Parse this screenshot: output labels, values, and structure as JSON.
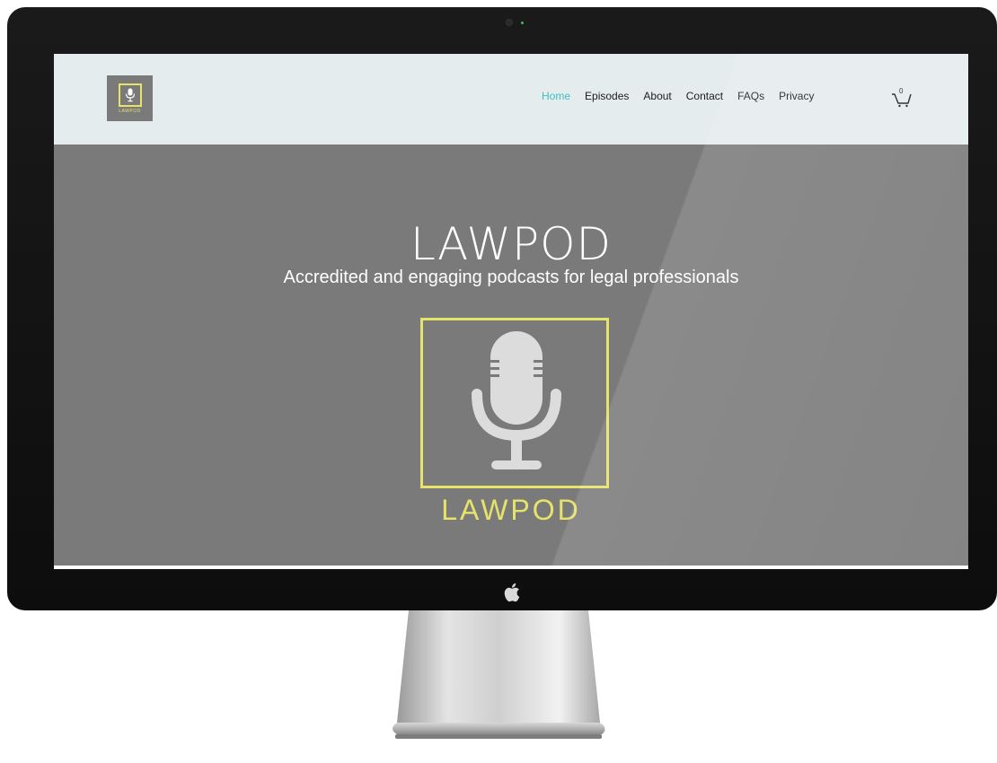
{
  "header": {
    "logo_text": "LAWPOD",
    "nav": [
      {
        "label": "Home",
        "active": true
      },
      {
        "label": "Episodes",
        "active": false
      },
      {
        "label": "About",
        "active": false
      },
      {
        "label": "Contact",
        "active": false
      },
      {
        "label": "FAQs",
        "active": false
      },
      {
        "label": "Privacy",
        "active": false
      }
    ],
    "cart_count": "0"
  },
  "hero": {
    "title": "LAWPOD",
    "subtitle": "Accredited and engaging podcasts for legal professionals",
    "logo_text": "LAWPOD"
  },
  "colors": {
    "accent": "#3fbfbf",
    "logo_yellow": "#e6e36a",
    "hero_bg": "#7a7a7a",
    "header_bg": "#e5ecee"
  },
  "icons": {
    "microphone": "microphone-icon",
    "cart": "cart-icon",
    "apple": "apple-logo-icon"
  }
}
